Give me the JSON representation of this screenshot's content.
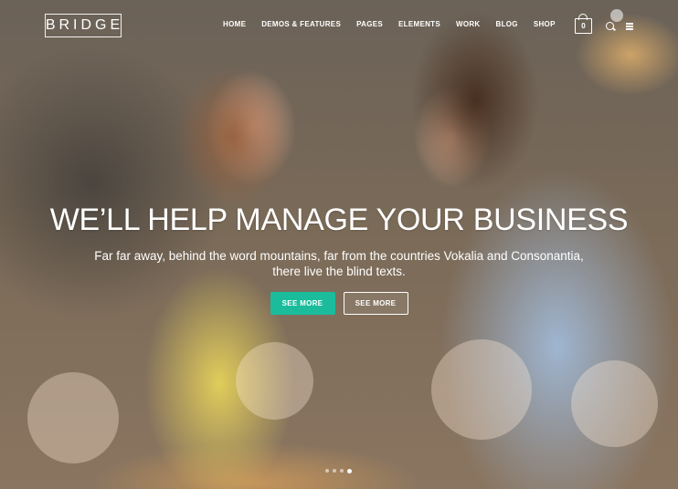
{
  "brand": {
    "logo_text": "BRIDGE"
  },
  "nav": {
    "items": [
      {
        "label": "HOME"
      },
      {
        "label": "DEMOS & FEATURES"
      },
      {
        "label": "PAGES"
      },
      {
        "label": "ELEMENTS"
      },
      {
        "label": "WORK"
      },
      {
        "label": "BLOG"
      },
      {
        "label": "SHOP"
      }
    ],
    "cart_count": "0",
    "icons": {
      "cart": "shopping-bag-icon",
      "search": "search-icon",
      "menu": "hamburger-menu-icon"
    }
  },
  "hero": {
    "headline": "WE’LL HELP MANAGE YOUR BUSINESS",
    "subtext_line1": "Far far away, behind the word mountains, far from the countries Vokalia and Consonantia,",
    "subtext_line2": "there live the blind texts.",
    "primary_button": "SEE MORE",
    "secondary_button": "SEE MORE",
    "slider": {
      "total_slides": 4,
      "active_slide": 4
    }
  },
  "colors": {
    "accent": "#1abc9c",
    "text": "#ffffff"
  }
}
